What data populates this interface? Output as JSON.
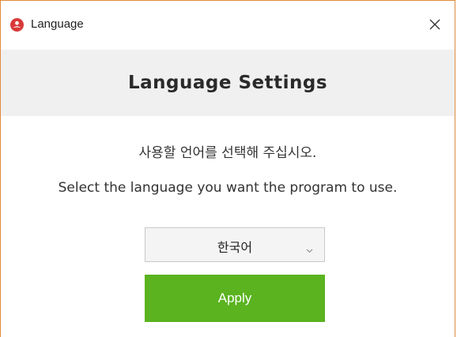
{
  "window": {
    "title": "Language",
    "icon": "app-logo-icon",
    "close_icon": "close-icon",
    "accent_border": "#e08a3c",
    "logo_color": "#d93a3a"
  },
  "header": {
    "heading": "Language Settings",
    "background": "#f0f0f0"
  },
  "content": {
    "instruction_ko": "사용할 언어를 선택해 주십시오.",
    "instruction_en": "Select the language you want the program to use."
  },
  "language_select": {
    "selected": "한국어",
    "icon": "chevron-down-icon"
  },
  "apply_button": {
    "label": "Apply",
    "color": "#5ab31f"
  }
}
